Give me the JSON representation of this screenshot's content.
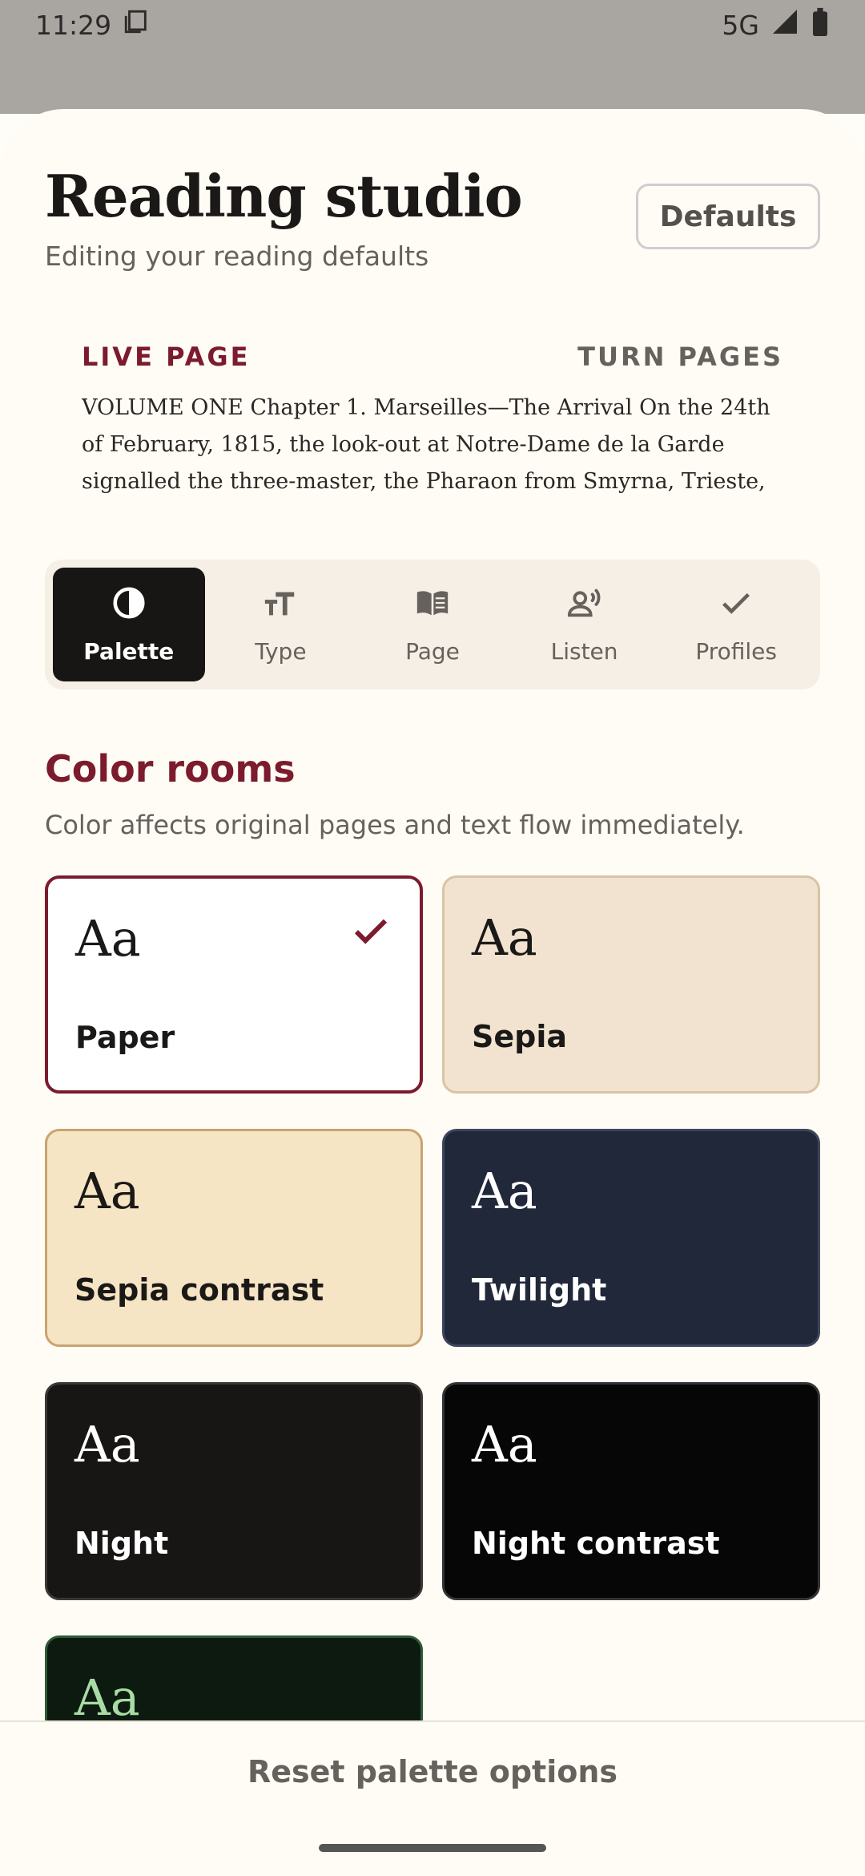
{
  "status": {
    "time": "11:29",
    "network": "5G"
  },
  "header": {
    "title": "Reading studio",
    "subtitle": "Editing your reading defaults",
    "defaults_label": "Defaults"
  },
  "live_page": {
    "label": "LIVE PAGE",
    "turn_label": "TURN PAGES",
    "text": "VOLUME ONE Chapter 1. Marseilles—The Arrival On the 24th of February, 1815, the look-out at Notre-Dame de la Garde signalled the three-master, the Pharaon from Smyrna, Trieste, and Naples. As usual, a"
  },
  "tabs": [
    {
      "label": "Palette",
      "icon": "contrast-icon",
      "active": true
    },
    {
      "label": "Type",
      "icon": "text-size-icon",
      "active": false
    },
    {
      "label": "Page",
      "icon": "book-icon",
      "active": false
    },
    {
      "label": "Listen",
      "icon": "voice-icon",
      "active": false
    },
    {
      "label": "Profiles",
      "icon": "check-icon",
      "active": false
    }
  ],
  "section": {
    "title": "Color rooms",
    "description": "Color affects original pages and text flow immediately."
  },
  "palettes": [
    {
      "sample": "Aa",
      "name": "Paper",
      "bg": "#ffffff",
      "fg": "#1b1917",
      "border": "#7b1b2d",
      "selected": true
    },
    {
      "sample": "Aa",
      "name": "Sepia",
      "bg": "#f1e3cf",
      "fg": "#1b1917",
      "border": "#d8c4a6",
      "selected": false
    },
    {
      "sample": "Aa",
      "name": "Sepia contrast",
      "bg": "#f6e5c4",
      "fg": "#1b1917",
      "border": "#c9a370",
      "selected": false
    },
    {
      "sample": "Aa",
      "name": "Twilight",
      "bg": "#21283a",
      "fg": "#ffffff",
      "border": "#3d465c",
      "selected": false
    },
    {
      "sample": "Aa",
      "name": "Night",
      "bg": "#181614",
      "fg": "#ffffff",
      "border": "#3a3836",
      "selected": false
    },
    {
      "sample": "Aa",
      "name": "Night contrast",
      "bg": "#060606",
      "fg": "#ffffff",
      "border": "#333333",
      "selected": false
    },
    {
      "sample": "Aa",
      "name": "",
      "bg": "#0d1a10",
      "fg": "#a8dca4",
      "border": "#2e5a35",
      "selected": false
    }
  ],
  "footer": {
    "reset_label": "Reset palette options"
  }
}
